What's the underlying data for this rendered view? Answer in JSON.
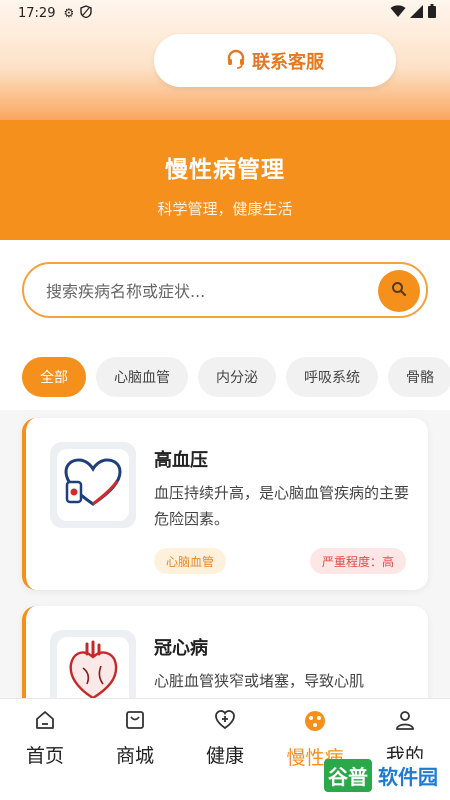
{
  "status_bar": {
    "time": "17:29"
  },
  "service_button": {
    "label": "联系客服"
  },
  "hero": {
    "title": "慢性病管理",
    "subtitle": "科学管理，健康生活"
  },
  "search": {
    "placeholder": "搜索疾病名称或症状..."
  },
  "tabs": [
    {
      "label": "全部",
      "active": true
    },
    {
      "label": "心脑血管",
      "active": false
    },
    {
      "label": "内分泌",
      "active": false
    },
    {
      "label": "呼吸系统",
      "active": false
    },
    {
      "label": "骨骼",
      "active": false
    }
  ],
  "cards": [
    {
      "name": "高血压",
      "description": "血压持续升高，是心脑血管疾病的主要危险因素。",
      "category": "心脑血管",
      "severity": "严重程度：高"
    },
    {
      "name": "冠心病",
      "description": "心脏血管狭窄或堵塞，导致心肌"
    }
  ],
  "bottom_nav": [
    {
      "label": "首页",
      "icon": "home-icon"
    },
    {
      "label": "商城",
      "icon": "shop-bag-icon"
    },
    {
      "label": "健康",
      "icon": "health-heart-icon"
    },
    {
      "label": "慢性病",
      "icon": "chronic-disease-icon",
      "active": true
    },
    {
      "label": "我的",
      "icon": "profile-icon"
    }
  ],
  "watermark": {
    "brand": "谷普",
    "text": "软件园"
  },
  "colors": {
    "accent": "#f5901d",
    "severity_red": "#e04a4a"
  }
}
